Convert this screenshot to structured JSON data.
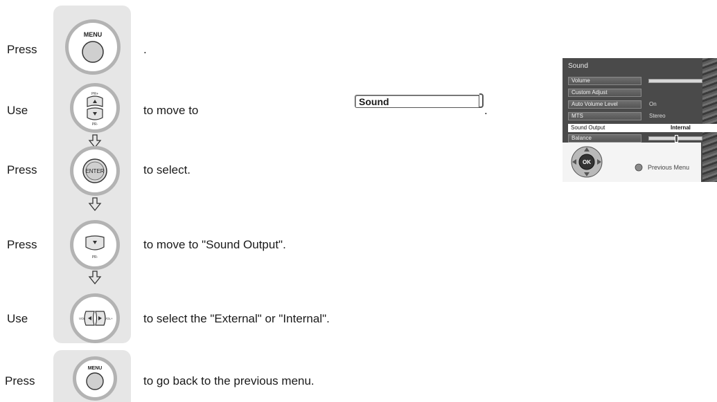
{
  "steps": [
    {
      "verb": "Press",
      "button": "MENU",
      "text": "."
    },
    {
      "verb": "Use",
      "text_before": "to move to",
      "menu_item": "Sound",
      "text_after": "."
    },
    {
      "verb": "Press",
      "button": "ENTER",
      "text": "to select."
    },
    {
      "verb": "Press",
      "text": "to move to \"Sound Output\"."
    },
    {
      "verb": "Use",
      "text": "to select the \"External\" or \"Internal\"."
    },
    {
      "verb": "Press",
      "button": "MENU",
      "text": "to go back to the previous menu."
    }
  ],
  "remote_labels": {
    "pr_up": "PR+",
    "pr_down": "PR-",
    "vol_minus": "VOL-",
    "vol_plus": "VOL+",
    "ok": "OK"
  },
  "osd": {
    "title": "Sound",
    "items": [
      {
        "label": "Volume",
        "value": "",
        "bar": true
      },
      {
        "label": "Custom Adjust",
        "value": ""
      },
      {
        "label": "Auto Volume Level",
        "value": "On"
      },
      {
        "label": "MTS",
        "value": "Stereo"
      },
      {
        "label": "Sound Output",
        "value": "Internal",
        "selected": true
      },
      {
        "label": "Balance",
        "value": "",
        "bar": true
      }
    ],
    "footer_label": "Previous Menu",
    "icons": [
      "nav-pad-icon",
      "ok-button-icon",
      "return-dot-icon"
    ]
  }
}
